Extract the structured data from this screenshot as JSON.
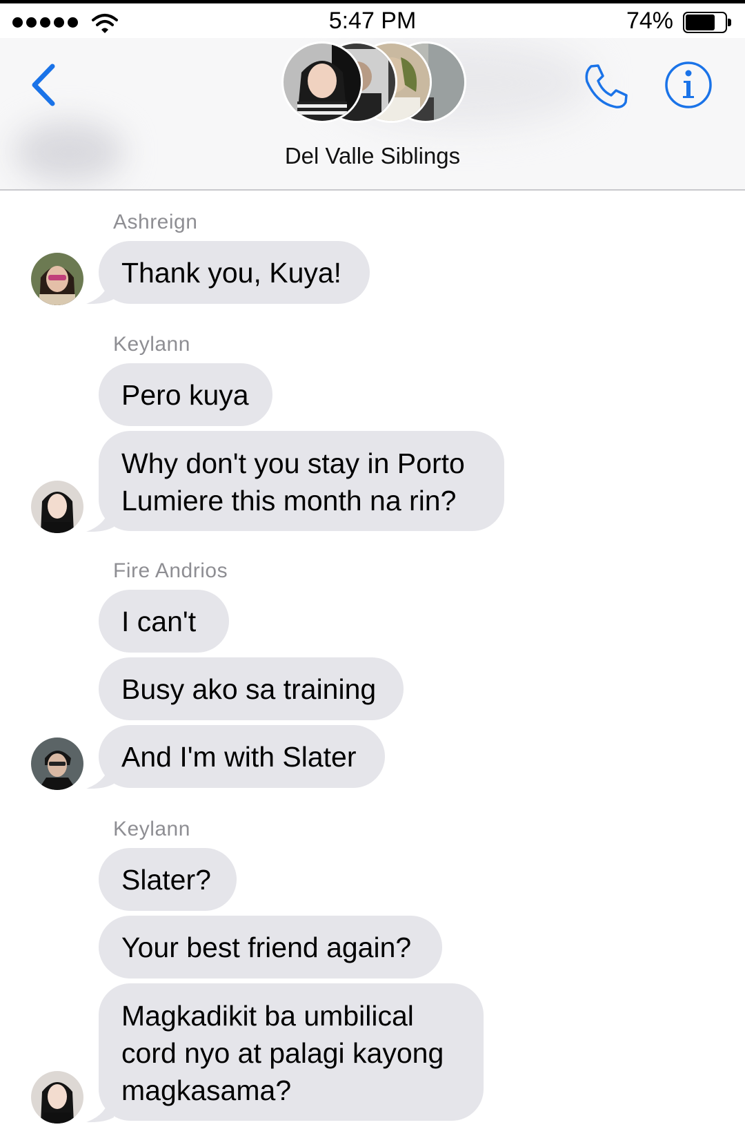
{
  "status_bar": {
    "time": "5:47 PM",
    "battery_percent": "74%",
    "battery_level": 0.74
  },
  "header": {
    "group_name": "Del Valle Siblings",
    "back_icon": "chevron-left-icon",
    "call_icon": "phone-icon",
    "info_icon": "info-icon"
  },
  "colors": {
    "accent": "#1a73e8",
    "bubble": "#e5e5ea",
    "sender": "#8e8e93"
  },
  "messages": [
    {
      "sender": "Ashreign",
      "texts": [
        "Thank you, Kuya!"
      ]
    },
    {
      "sender": "Keylann",
      "texts": [
        "Pero kuya",
        "Why don't you stay in Porto\nLumiere this month na rin?"
      ]
    },
    {
      "sender": "Fire Andrios",
      "texts": [
        "I can't",
        "Busy ako sa training",
        "And I'm with Slater"
      ]
    },
    {
      "sender": "Keylann",
      "texts": [
        "Slater?",
        "Your best friend again?",
        "Magkadikit ba umbilical\ncord nyo at palagi kayong\nmagkasama?"
      ]
    }
  ]
}
